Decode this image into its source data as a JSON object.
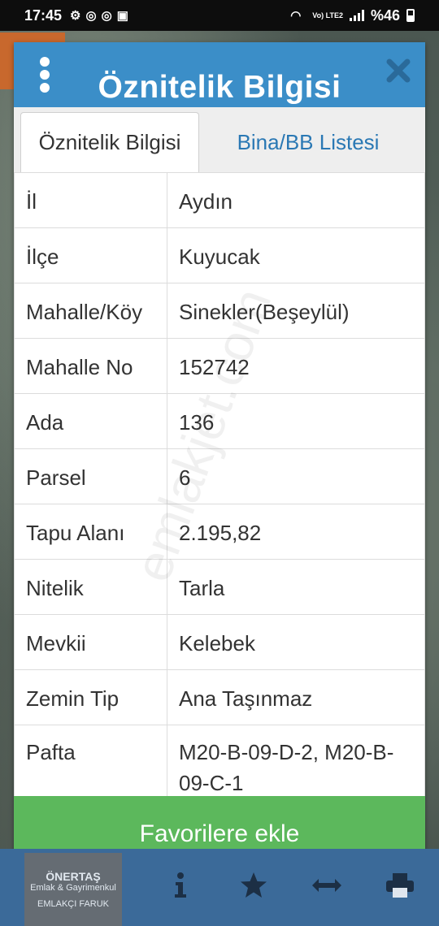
{
  "status_bar": {
    "time": "17:45",
    "network": "Vo) LTE2",
    "battery": "%46"
  },
  "dialog": {
    "title": "Öznitelik Bilgisi",
    "tabs": [
      {
        "label": "Öznitelik Bilgisi",
        "active": true
      },
      {
        "label": "Bina/BB Listesi",
        "active": false
      }
    ],
    "rows": [
      {
        "key": "İl",
        "value": "Aydın"
      },
      {
        "key": "İlçe",
        "value": "Kuyucak"
      },
      {
        "key": "Mahalle/Köy",
        "value": "Sinekler(Beşeylül)"
      },
      {
        "key": "Mahalle No",
        "value": "152742"
      },
      {
        "key": "Ada",
        "value": "136"
      },
      {
        "key": "Parsel",
        "value": "6"
      },
      {
        "key": "Tapu Alanı",
        "value": "2.195,82"
      },
      {
        "key": "Nitelik",
        "value": "Tarla"
      },
      {
        "key": "Mevkii",
        "value": "Kelebek"
      },
      {
        "key": "Zemin Tip",
        "value": "Ana Taşınmaz"
      },
      {
        "key": "Pafta",
        "value": "M20-B-09-D-2,   M20-B-09-C-1"
      }
    ],
    "favorite_button": "Favorilere ekle"
  },
  "watermark": "emlakjet.com",
  "logo_text": [
    "ÖNERTAŞ",
    "Emlak & Gayrimenkul",
    "EMLAKÇI FARUK"
  ],
  "colors": {
    "header": "#3b8ec8",
    "tab_link": "#2a78b4",
    "button": "#5cb85c",
    "toolbar": "#3b6a99"
  }
}
